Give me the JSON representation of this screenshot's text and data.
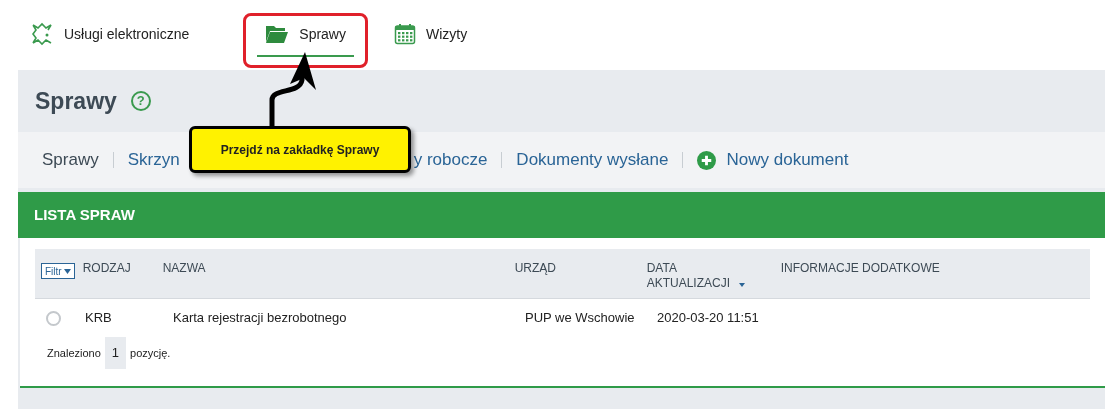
{
  "top_nav": [
    {
      "label": "Usługi elektroniczne",
      "selected": false
    },
    {
      "label": "Sprawy",
      "selected": true
    },
    {
      "label": "Wizyty",
      "selected": false
    }
  ],
  "page_title": "Sprawy",
  "help": "?",
  "subnav": {
    "left": [
      {
        "label": "Sprawy",
        "selected": true
      },
      {
        "label": "Skrzyn",
        "selected": false
      }
    ],
    "right": [
      {
        "label": "y robocze",
        "selected": false
      },
      {
        "label": "Dokumenty wysłane",
        "selected": false
      }
    ],
    "new_document": "Nowy dokument"
  },
  "callout": "Przejdź na zakładkę Sprawy",
  "panel_title": "LISTA SPRAW",
  "table": {
    "filter": "Filtr",
    "columns": [
      {
        "label": "RODZAJ",
        "sorted": false
      },
      {
        "label": "NAZWA",
        "sorted": false
      },
      {
        "label": "URZĄD",
        "sorted": false
      },
      {
        "label": "DATA AKTUALIZACJI",
        "sorted": true
      },
      {
        "label": "INFORMACJE DODATKOWE",
        "sorted": false
      }
    ],
    "rows": [
      {
        "selected": false,
        "cells": [
          "KRB",
          "Karta rejestracji bezrobotnego",
          "PUP we Wschowie",
          "2020-03-20 11:51"
        ]
      }
    ],
    "found_before": "Znaleziono",
    "found_count": "1",
    "found_after": "pozycję."
  }
}
